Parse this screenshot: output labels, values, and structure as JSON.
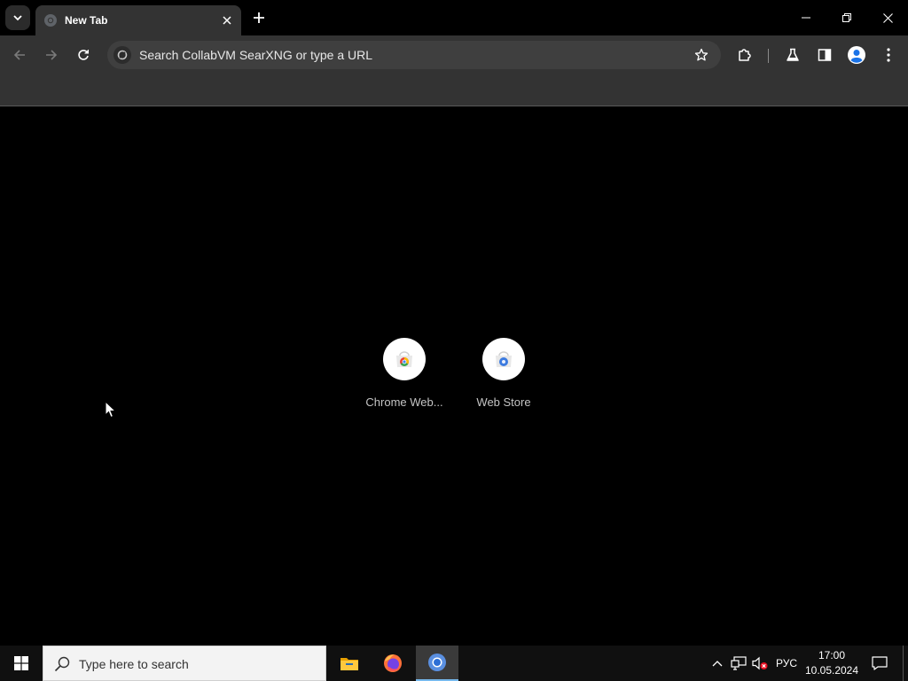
{
  "tab": {
    "title": "New Tab"
  },
  "omnibox": {
    "placeholder": "Search CollabVM SearXNG or type a URL"
  },
  "shortcuts": [
    {
      "label": "Chrome Web..."
    },
    {
      "label": "Web Store"
    }
  ],
  "taskbar": {
    "search_placeholder": "Type here to search",
    "apps": [
      "file-explorer",
      "firefox",
      "chrome"
    ]
  },
  "tray": {
    "language": "РУС",
    "time": "17:00",
    "date": "10.05.2024"
  },
  "colors": {
    "toolbar": "#333333",
    "omnibox": "#3f3f3f",
    "content": "#000000",
    "taskbar": "#101010"
  }
}
